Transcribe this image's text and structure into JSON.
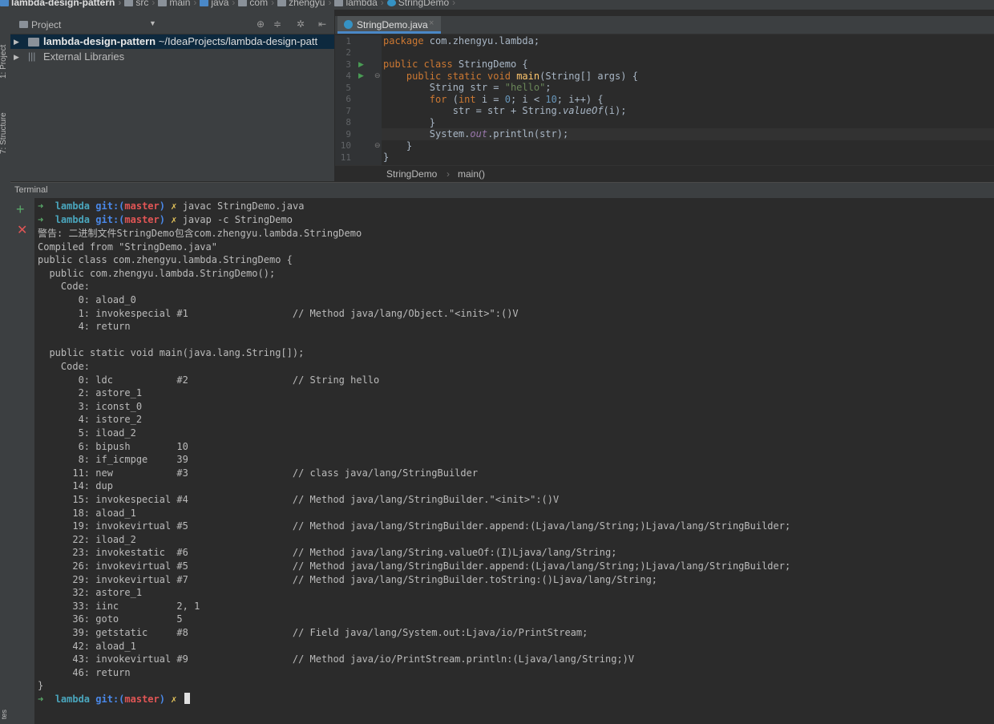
{
  "breadcrumb": [
    "lambda-design-pattern",
    "src",
    "main",
    "java",
    "com",
    "zhengyu",
    "lambda",
    "StringDemo"
  ],
  "tool_stripe": {
    "project": "1: Project",
    "structure": "7: Structure",
    "bottom": "tes"
  },
  "project_panel": {
    "title": "Project",
    "tree": [
      {
        "label": "lambda-design-pattern",
        "path": "~/IdeaProjects/lambda-design-patt"
      },
      {
        "label": "External Libraries"
      }
    ]
  },
  "editor": {
    "tab": "StringDemo.java",
    "line_numbers": [
      "1",
      "2",
      "3",
      "4",
      "5",
      "6",
      "7",
      "8",
      "9",
      "10",
      "11"
    ],
    "breadcrumbs": [
      "StringDemo",
      "main()"
    ]
  },
  "terminal": {
    "title": "Terminal",
    "prompt": {
      "arrow": "➜",
      "dir": "lambda",
      "git": "git:(",
      "branch": "master",
      "close": ")",
      "dirty": "✗"
    },
    "commands": [
      "javac StringDemo.java",
      "javap -c StringDemo"
    ],
    "output": [
      "警告: 二进制文件StringDemo包含com.zhengyu.lambda.StringDemo",
      "Compiled from \"StringDemo.java\"",
      "public class com.zhengyu.lambda.StringDemo {",
      "  public com.zhengyu.lambda.StringDemo();",
      "    Code:",
      "       0: aload_0",
      "       1: invokespecial #1                  // Method java/lang/Object.\"<init>\":()V",
      "       4: return",
      "",
      "  public static void main(java.lang.String[]);",
      "    Code:",
      "       0: ldc           #2                  // String hello",
      "       2: astore_1",
      "       3: iconst_0",
      "       4: istore_2",
      "       5: iload_2",
      "       6: bipush        10",
      "       8: if_icmpge     39",
      "      11: new           #3                  // class java/lang/StringBuilder",
      "      14: dup",
      "      15: invokespecial #4                  // Method java/lang/StringBuilder.\"<init>\":()V",
      "      18: aload_1",
      "      19: invokevirtual #5                  // Method java/lang/StringBuilder.append:(Ljava/lang/String;)Ljava/lang/StringBuilder;",
      "      22: iload_2",
      "      23: invokestatic  #6                  // Method java/lang/String.valueOf:(I)Ljava/lang/String;",
      "      26: invokevirtual #5                  // Method java/lang/StringBuilder.append:(Ljava/lang/String;)Ljava/lang/StringBuilder;",
      "      29: invokevirtual #7                  // Method java/lang/StringBuilder.toString:()Ljava/lang/String;",
      "      32: astore_1",
      "      33: iinc          2, 1",
      "      36: goto          5",
      "      39: getstatic     #8                  // Field java/lang/System.out:Ljava/io/PrintStream;",
      "      42: aload_1",
      "      43: invokevirtual #9                  // Method java/io/PrintStream.println:(Ljava/lang/String;)V",
      "      46: return",
      "}"
    ]
  }
}
